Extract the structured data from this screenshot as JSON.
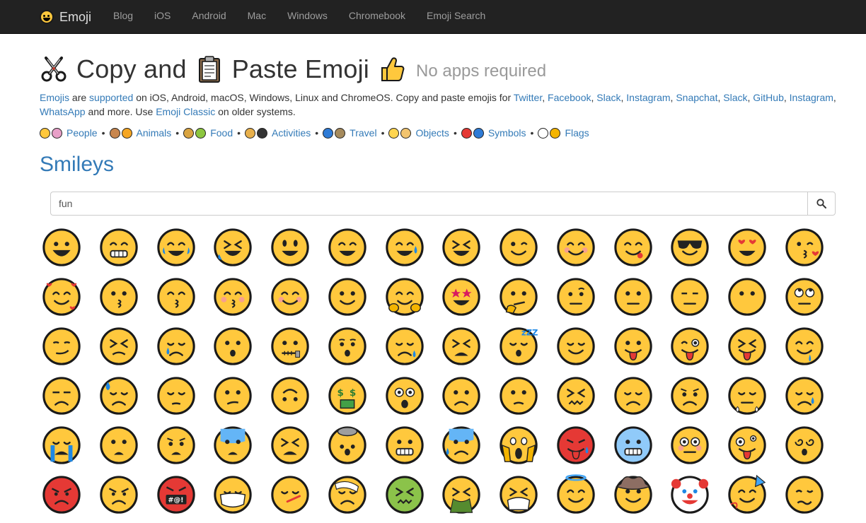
{
  "navbar": {
    "brand": "Emoji",
    "items": [
      "Blog",
      "iOS",
      "Android",
      "Mac",
      "Windows",
      "Chromebook",
      "Emoji Search"
    ]
  },
  "header": {
    "title_part1": "Copy and",
    "title_part2": "Paste Emoji",
    "subtitle": "No apps required"
  },
  "intro": {
    "t1": "Emojis",
    "t2": " are ",
    "t3": "supported",
    "t4": " on iOS, Android, macOS, Windows, Linux and ChromeOS. Copy and paste emojis for ",
    "t5": "Twitter",
    "t6": ", ",
    "t7": "Facebook",
    "t8": ", ",
    "t9": "Slack",
    "t10": ", ",
    "t11": "Instagram",
    "t12": ", ",
    "t13": "Snapchat",
    "t14": ", ",
    "t15": "Slack",
    "t16": ", ",
    "t17": "GitHub",
    "t18": ", ",
    "t19": "Instagram",
    "t20": ", ",
    "t21": "WhatsApp",
    "t22": " and more. Use ",
    "t23": "Emoji Classic",
    "t24": " on older systems."
  },
  "categories": [
    "People",
    "Animals",
    "Food",
    "Activities",
    "Travel",
    "Objects",
    "Symbols",
    "Flags"
  ],
  "category_colors": [
    [
      "#FFC83D",
      "#E8A0C8"
    ],
    [
      "#C8864E",
      "#F5A623"
    ],
    [
      "#D9A441",
      "#8CC63F"
    ],
    [
      "#E8B04B",
      "#333333"
    ],
    [
      "#2E7BD6",
      "#A58A5C"
    ],
    [
      "#FFD54F",
      "#F2C46F"
    ],
    [
      "#E53935",
      "#2E7BD6"
    ],
    [
      "#FFFFFF",
      "#F4B400"
    ]
  ],
  "section": {
    "title": "Smileys"
  },
  "search": {
    "value": "fun",
    "button_icon": "search-icon"
  },
  "colors": {
    "accent": "#337ab7",
    "navbar": "#222222",
    "emoji_yellow": "#FFC83D"
  },
  "emojis": [
    "grinning-face",
    "beaming-face",
    "face-with-tears-of-joy",
    "rolling-on-floor-laughing",
    "grinning-big-eyes",
    "grinning-smiling-eyes",
    "grinning-sweat",
    "grinning-squinting",
    "winking-face",
    "smiling-smiling-eyes",
    "face-savoring-food",
    "sunglasses-face",
    "heart-eyes",
    "face-blowing-kiss",
    "smiling-hearts",
    "kissing-face",
    "kissing-smiling-eyes",
    "kissing-closed-eyes",
    "smiling-face",
    "slightly-smiling",
    "hugging-face",
    "star-struck",
    "thinking-face",
    "raised-eyebrow",
    "neutral-face",
    "expressionless",
    "no-mouth",
    "rolling-eyes",
    "smirking-face",
    "persevering-face",
    "sad-relieved",
    "hushed-face",
    "zipper-mouth",
    "hushed-open",
    "sleepy-face",
    "tired-face",
    "sleeping-face",
    "relieved-face",
    "tongue-face",
    "winking-tongue",
    "squinting-tongue",
    "drooling-face",
    "unamused-face",
    "downcast-sweat",
    "pensive-face",
    "confused-face",
    "upside-down-face",
    "money-mouth",
    "astonished-face",
    "frowning-face",
    "slightly-frowning",
    "confounded-face",
    "disappointed-face",
    "worried-face",
    "steam-from-nose",
    "crying-face",
    "loudly-crying",
    "frowning-open-mouth",
    "anguished-face",
    "fearful-face",
    "weary-face",
    "exploding-head",
    "grimacing-face",
    "anxious-sweat",
    "screaming-fear",
    "hot-face",
    "cold-face",
    "flushed-face",
    "zany-face",
    "dizzy-face",
    "pouting-face",
    "angry-face",
    "cursing-face",
    "mask-face",
    "thermometer-face",
    "bandage-face",
    "nauseated-face",
    "vomiting-face",
    "sneezing-face",
    "halo-face",
    "cowboy-face",
    "clown-face",
    "partying-face",
    "woozy-face"
  ]
}
